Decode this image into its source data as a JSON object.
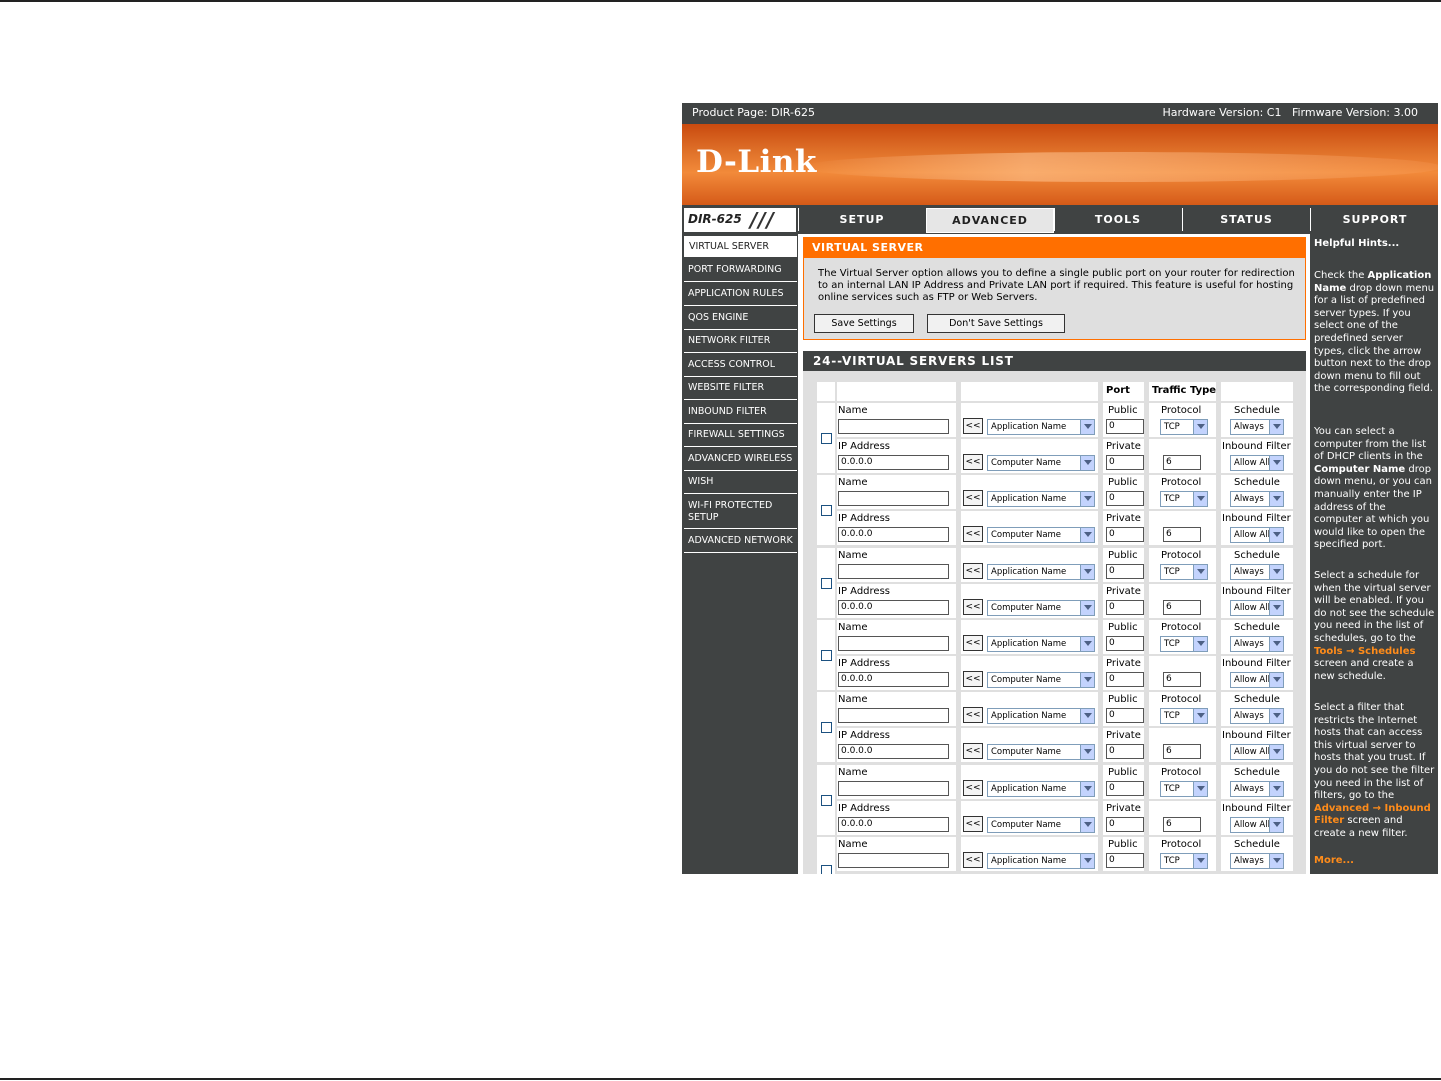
{
  "header": {
    "product_page": "Product Page: DIR-625",
    "versions": "Hardware Version: C1   Firmware Version: 3.00",
    "logo": "D-Link",
    "model": "DIR-625"
  },
  "tabs": [
    "SETUP",
    "ADVANCED",
    "TOOLS",
    "STATUS",
    "SUPPORT"
  ],
  "active_tab": "ADVANCED",
  "sidebar": [
    "VIRTUAL SERVER",
    "PORT FORWARDING",
    "APPLICATION RULES",
    "QOS ENGINE",
    "NETWORK FILTER",
    "ACCESS CONTROL",
    "WEBSITE FILTER",
    "INBOUND FILTER",
    "FIREWALL SETTINGS",
    "ADVANCED WIRELESS",
    "WISH",
    "WI-FI PROTECTED SETUP",
    "ADVANCED NETWORK"
  ],
  "virtual_server": {
    "title": "VIRTUAL SERVER",
    "description": "The Virtual Server option allows you to define a single public port on your router for redirection to an internal LAN IP Address and Private LAN port if required. This feature is useful for hosting online services such as FTP or Web Servers.",
    "save_label": "Save Settings",
    "dont_save_label": "Don't Save Settings"
  },
  "list": {
    "title": "24--VIRTUAL SERVERS LIST",
    "header_port": "Port",
    "header_traffic": "Traffic Type",
    "label_name": "Name",
    "label_ip": "IP Address",
    "label_public": "Public",
    "label_private": "Private",
    "label_protocol": "Protocol",
    "label_schedule": "Schedule",
    "label_inbound": "Inbound Filter",
    "copy_button": "<<",
    "app_select": "Application Name",
    "computer_select": "Computer Name",
    "rows": [
      {
        "name": "",
        "ip": "0.0.0.0",
        "public": "0",
        "private": "0",
        "protocol": "TCP",
        "protocol_num": "6",
        "schedule": "Always",
        "inbound": "Allow All"
      },
      {
        "name": "",
        "ip": "0.0.0.0",
        "public": "0",
        "private": "0",
        "protocol": "TCP",
        "protocol_num": "6",
        "schedule": "Always",
        "inbound": "Allow All"
      },
      {
        "name": "",
        "ip": "0.0.0.0",
        "public": "0",
        "private": "0",
        "protocol": "TCP",
        "protocol_num": "6",
        "schedule": "Always",
        "inbound": "Allow All"
      },
      {
        "name": "",
        "ip": "0.0.0.0",
        "public": "0",
        "private": "0",
        "protocol": "TCP",
        "protocol_num": "6",
        "schedule": "Always",
        "inbound": "Allow All"
      },
      {
        "name": "",
        "ip": "0.0.0.0",
        "public": "0",
        "private": "0",
        "protocol": "TCP",
        "protocol_num": "6",
        "schedule": "Always",
        "inbound": "Allow All"
      },
      {
        "name": "",
        "ip": "0.0.0.0",
        "public": "0",
        "private": "0",
        "protocol": "TCP",
        "protocol_num": "6",
        "schedule": "Always",
        "inbound": "Allow All"
      },
      {
        "name": "",
        "ip": "",
        "public": "0",
        "private": "",
        "protocol": "TCP",
        "protocol_num": "",
        "schedule": "Always",
        "inbound": ""
      }
    ]
  },
  "hints": {
    "title": "Helpful Hints...",
    "p1_a": "Check the ",
    "p1_b": "Application Name",
    "p1_c": " drop down menu for a list of predefined server types. If you select one of the predefined server types, click the arrow button next to the drop down menu to fill out the corresponding field.",
    "p2_a": "You can select a computer from the list of DHCP clients in the ",
    "p2_b": "Computer Name",
    "p2_c": " drop down menu, or you can manually enter the IP address of the computer at which you would like to open the specified port.",
    "p3_a": "Select a schedule for when the virtual server will be enabled. If you do not see the schedule you need in the list of schedules, go to the ",
    "p3_b": "Tools → Schedules",
    "p3_c": " screen and create a new schedule.",
    "p4_a": "Select a filter that restricts the Internet hosts that can access this virtual server to hosts that you trust. If you do not see the filter you need in the list of filters, go to the ",
    "p4_b": "Advanced → Inbound Filter",
    "p4_c": " screen and create a new filter.",
    "more": "More..."
  },
  "colors": {
    "accent_orange": "#ff6f00",
    "nav_gray": "#404343",
    "panel_gray": "#dfdfdf"
  }
}
